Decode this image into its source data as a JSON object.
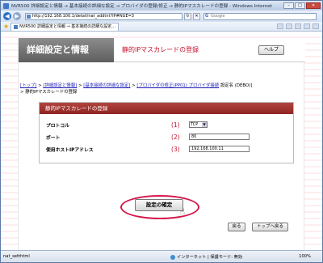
{
  "window": {
    "title": "NVR500 詳細設定と情報 → 基本接続の詳細な設定 → プロバイダの登録/修正 → 静的IPマスカレードの登録 - Windows Internet"
  },
  "browser": {
    "address": "http://192.168.100.1/detail/nat_addtnt?IP#NGE=3",
    "search_placeholder": "Google",
    "tab_label": "NVR500 詳細設定と情報 → 基本接続の詳細な設定..."
  },
  "page": {
    "header_title": "詳細設定と情報",
    "page_title": "静的IPマスカレードの登録",
    "help_label": "ヘルプ"
  },
  "breadcrumb": {
    "items": [
      "[トップ]",
      "[詳細設定と情報]",
      "[基本接続の詳細な設定]",
      "[プロバイダの修正(PP01) プロバイダ接続"
    ],
    "tail": "設定名 (DEBO)]",
    "current": "静的IPマスカレードの登録"
  },
  "form": {
    "heading": "静的IPマスカレードの登録",
    "rows": [
      {
        "label": "プロトコル",
        "num": "(1)",
        "value": "TCP"
      },
      {
        "label": "ポート",
        "num": "(2)",
        "value": "80"
      },
      {
        "label": "使用ホストIPアドレス",
        "num": "(3)",
        "value": "192.168.100.11"
      }
    ]
  },
  "actions": {
    "confirm": "設定の確定",
    "back": "戻る",
    "top": "トップへ戻る"
  },
  "status": {
    "left": "nat_setthtml",
    "zone": "インターネット | 保護モード: 無効",
    "zoom": "100%"
  }
}
